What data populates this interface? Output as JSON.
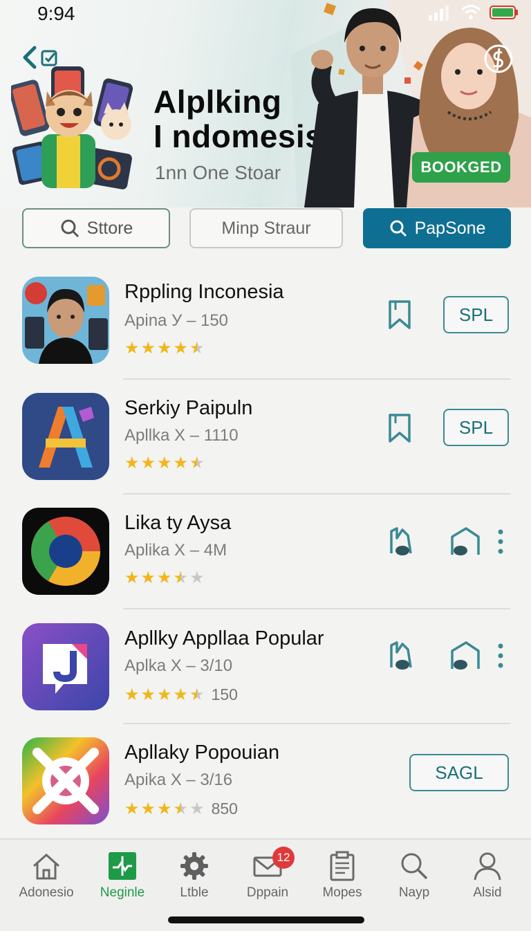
{
  "status_bar": {
    "time": "9:94"
  },
  "header": {
    "title_line1": "Alplking",
    "title_line2": "I ndomesis",
    "subtitle": "1nn One Stoar",
    "badge": "BOOKGED"
  },
  "segments": {
    "store": "Sttore",
    "middle": "Minp Straur",
    "primary": "PapSone"
  },
  "apps": [
    {
      "name": "Rppling Inconesia",
      "meta": "Apina У – 150",
      "rating": 4.5,
      "count": "",
      "action": "SPL"
    },
    {
      "name": "Serkiy Paipuln",
      "meta": "Apllka X – 1110",
      "rating": 4.5,
      "count": "",
      "action": "SPL"
    },
    {
      "name": "Lika ty Aysa",
      "meta": "Aplika X – 4M",
      "rating": 3.5,
      "count": "",
      "action": ""
    },
    {
      "name": "Apllky Appllaa Popular",
      "meta": "Aplka X – 3/10",
      "rating": 4.5,
      "count": "150",
      "action": ""
    },
    {
      "name": "Apllaky Popouian",
      "meta": "Apika X – 3/16",
      "rating": 3.5,
      "count": "850",
      "action": "SAGL"
    }
  ],
  "nav": [
    {
      "label": "Adonesio",
      "icon": "home-icon"
    },
    {
      "label": "Neginle",
      "icon": "chart-icon",
      "active": true
    },
    {
      "label": "Ltble",
      "icon": "gear-icon"
    },
    {
      "label": "Dppain",
      "icon": "mail-icon",
      "badge": "12"
    },
    {
      "label": "Mopes",
      "icon": "clipboard-icon"
    },
    {
      "label": "Nayp",
      "icon": "search-icon"
    },
    {
      "label": "Alsid",
      "icon": "profile-icon"
    }
  ],
  "colors": {
    "primary": "#0e6f93",
    "accent_green": "#2ea14a",
    "star": "#f2b51c",
    "teal_outline": "#3a8a94",
    "badge_red": "#e0393b"
  }
}
